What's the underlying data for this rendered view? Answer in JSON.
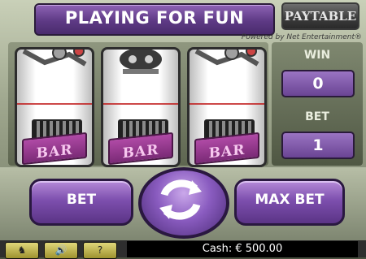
{
  "header": {
    "title": "PLAYING FOR FUN",
    "paytable_label": "PAYTABLE",
    "powered_by": "Powered by Net Entertainment®"
  },
  "reels": [
    {
      "top_icon": "bones-icon",
      "bottom_icon": "bar-icon",
      "bottom_label": "BAR"
    },
    {
      "top_icon": "skull-icon",
      "bottom_icon": "bar-icon",
      "bottom_label": "BAR"
    },
    {
      "top_icon": "bones-icon",
      "bottom_icon": "bar-icon",
      "bottom_label": "BAR"
    }
  ],
  "win": {
    "label": "WIN",
    "value": "0"
  },
  "bet": {
    "label": "BET",
    "value": "1"
  },
  "controls": {
    "bet_label": "BET",
    "max_bet_label": "MAX BET",
    "spin_icon": "spin-arrows-icon"
  },
  "footer": {
    "home_icon": "horse-icon",
    "sound_icon": "speaker-icon",
    "help_label": "?",
    "cash": "Cash: € 500.00"
  },
  "colors": {
    "accent": "#7d4fae",
    "payline": "#c01a1a"
  }
}
